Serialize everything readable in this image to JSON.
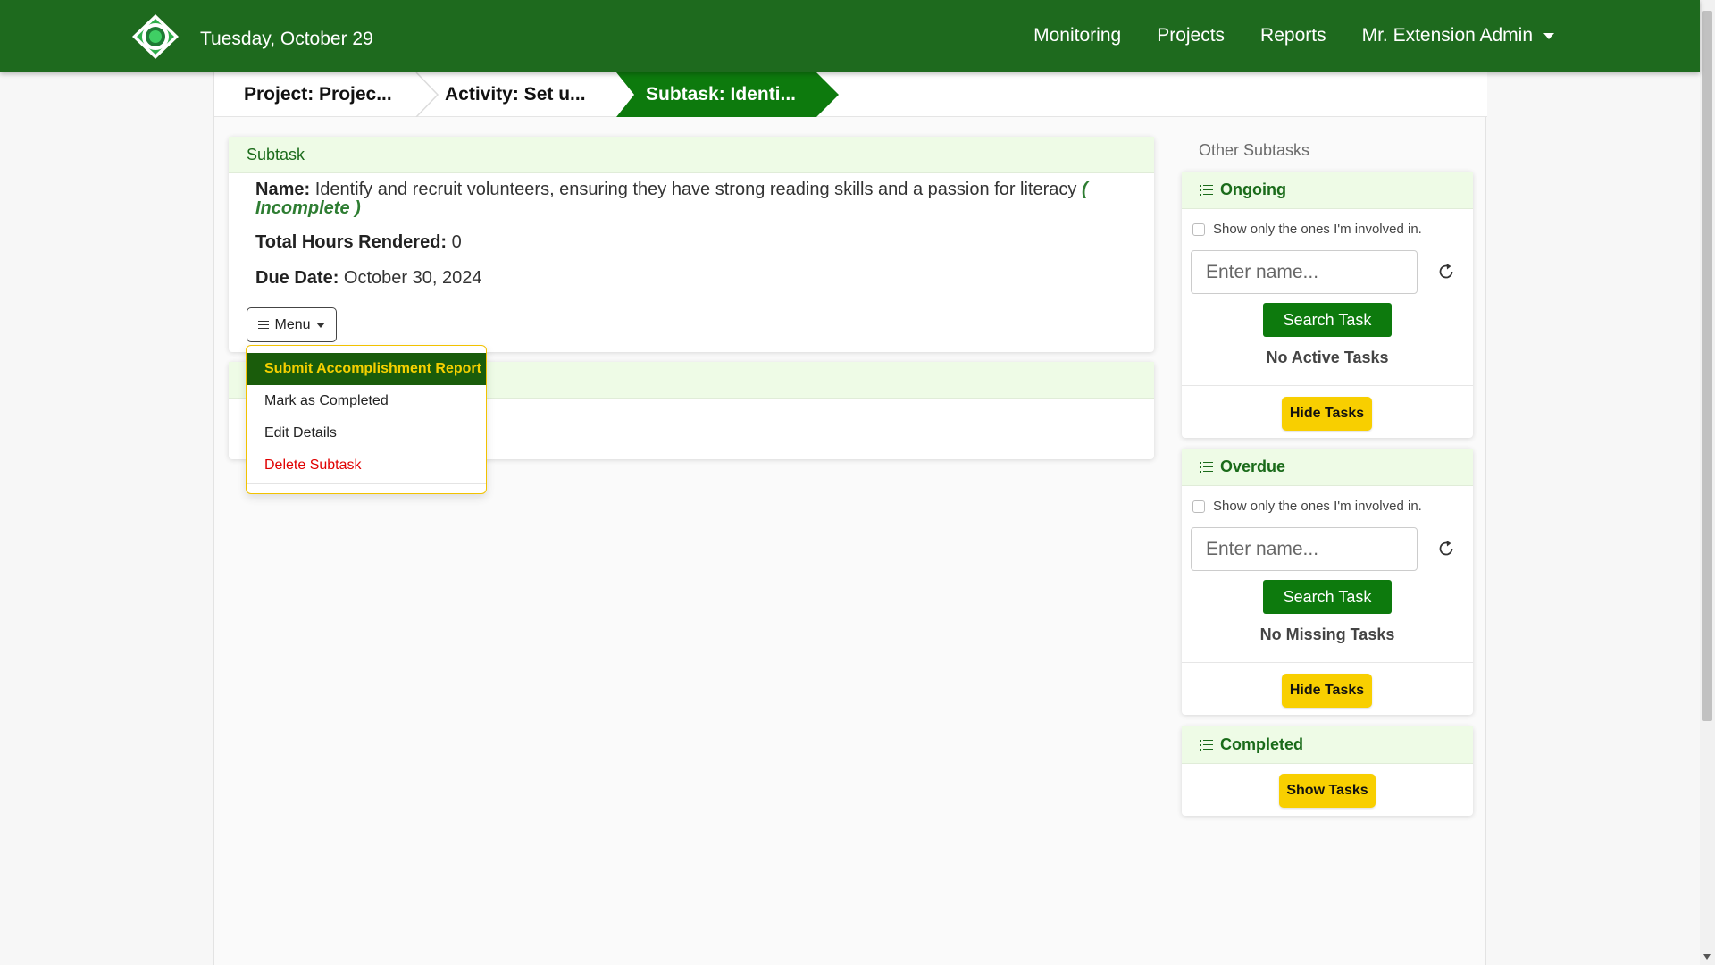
{
  "navbar": {
    "date": "Tuesday, October 29",
    "links": [
      "Monitoring",
      "Projects",
      "Reports"
    ],
    "user": "Mr. Extension Admin",
    "bg_color": "#1e6a1e"
  },
  "breadcrumb": {
    "project": "Project: Projec...",
    "activity": "Activity: Set u...",
    "subtask": "Subtask: Identi..."
  },
  "subtask_card": {
    "header": "Subtask",
    "name_label": "Name:",
    "name_value": "Identify and recruit volunteers, ensuring they have strong reading skills and a passion for literacy",
    "status": "( Incomplete )",
    "hours_label": "Total Hours Rendered:",
    "hours_value": "0",
    "due_label": "Due Date:",
    "due_value": "October 30, 2024",
    "menu_label": "Menu"
  },
  "menu": {
    "items": [
      "Submit Accomplishment Report",
      "Mark as Completed",
      "Edit Details",
      "Delete Subtask"
    ]
  },
  "sidebar": {
    "title": "Other Subtasks",
    "ongoing": {
      "header": "Ongoing",
      "checkbox_label": "Show only the ones I'm involved in.",
      "input_placeholder": "Enter name...",
      "search_label": "Search Task",
      "empty_text": "No Active Tasks",
      "toggle_label": "Hide Tasks"
    },
    "overdue": {
      "header": "Overdue",
      "checkbox_label": "Show only the ones I'm involved in.",
      "input_placeholder": "Enter name...",
      "search_label": "Search Task",
      "empty_text": "No Missing Tasks",
      "toggle_label": "Hide Tasks"
    },
    "completed": {
      "header": "Completed",
      "toggle_label": "Show Tasks"
    }
  },
  "colors": {
    "primary_green": "#0d7a0d",
    "dark_green": "#1a5c0b",
    "accent_yellow": "#f8cf00",
    "danger_red": "#e00000"
  }
}
